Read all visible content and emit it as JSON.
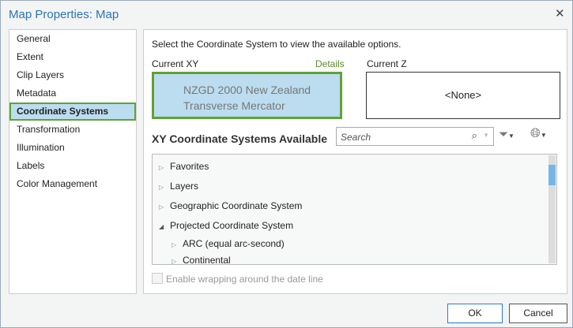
{
  "title": "Map Properties: Map",
  "nav": [
    "General",
    "Extent",
    "Clip Layers",
    "Metadata",
    "Coordinate Systems",
    "Transformation",
    "Illumination",
    "Labels",
    "Color Management"
  ],
  "main": {
    "instruction": "Select the Coordinate System to view the available options.",
    "current_xy_label": "Current XY",
    "details_link": "Details",
    "current_xy_line1": "NZGD 2000 New Zealand",
    "current_xy_line2": "Transverse Mercator",
    "current_z_label": "Current Z",
    "current_z_value": "<None>",
    "available_heading": "XY Coordinate Systems Available",
    "search_placeholder": "Search",
    "tree": [
      {
        "label": "Favorites",
        "expanded": false,
        "level": 0
      },
      {
        "label": "Layers",
        "expanded": false,
        "level": 0
      },
      {
        "label": "Geographic Coordinate System",
        "expanded": false,
        "level": 0
      },
      {
        "label": "Projected Coordinate System",
        "expanded": true,
        "level": 0
      },
      {
        "label": "ARC (equal arc-second)",
        "expanded": false,
        "level": 1
      },
      {
        "label": "Continental",
        "expanded": false,
        "level": 1
      }
    ],
    "wrap_label": "Enable wrapping around the date line"
  },
  "buttons": {
    "ok": "OK",
    "cancel": "Cancel"
  }
}
